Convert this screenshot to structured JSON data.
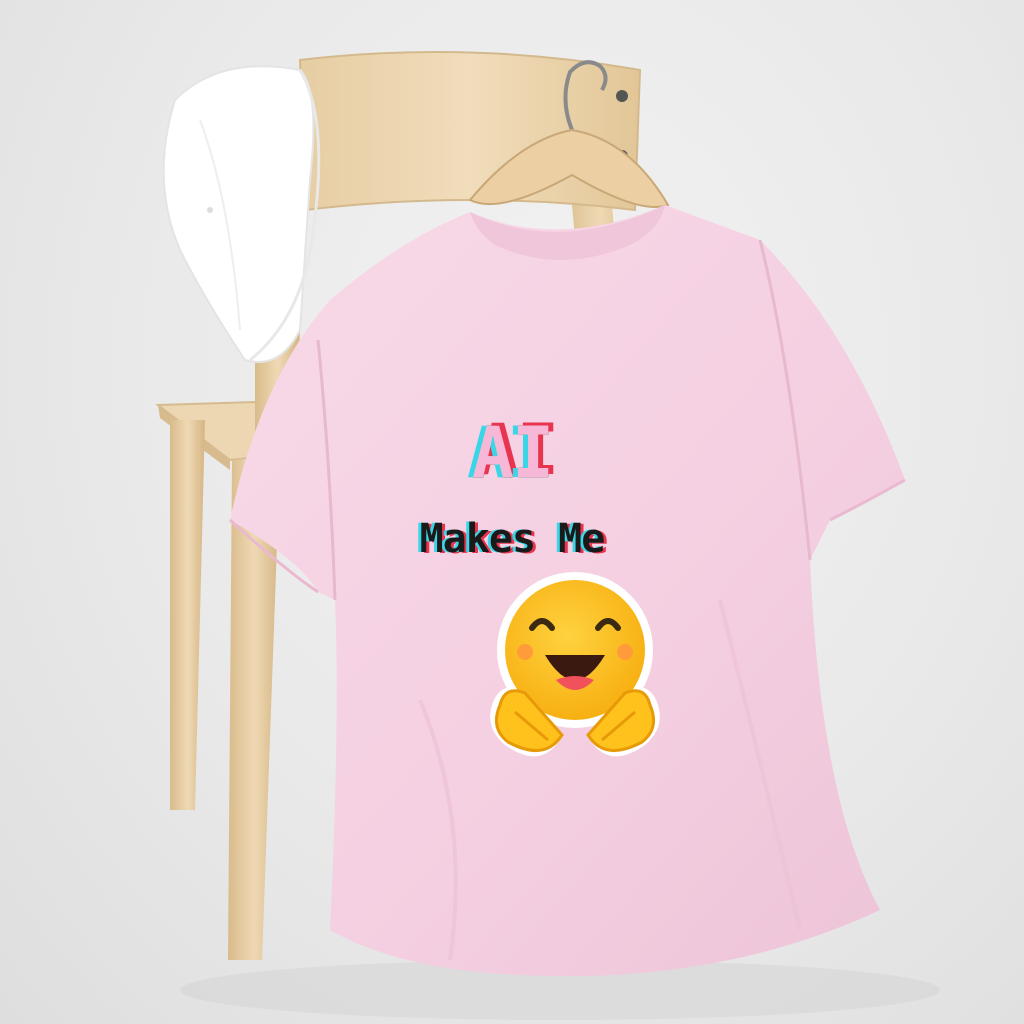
{
  "shirt_print": {
    "line1": "AI",
    "line2": "Makes Me",
    "emoji": "hugging-face-icon"
  },
  "colors": {
    "shirt": "#f6d3e4",
    "wood": "#ead5b0",
    "cap": "#ffffff",
    "emoji_yellow": "#ffc21c",
    "glitch_cyan": "#38d6e6",
    "glitch_red": "#e8344f"
  }
}
